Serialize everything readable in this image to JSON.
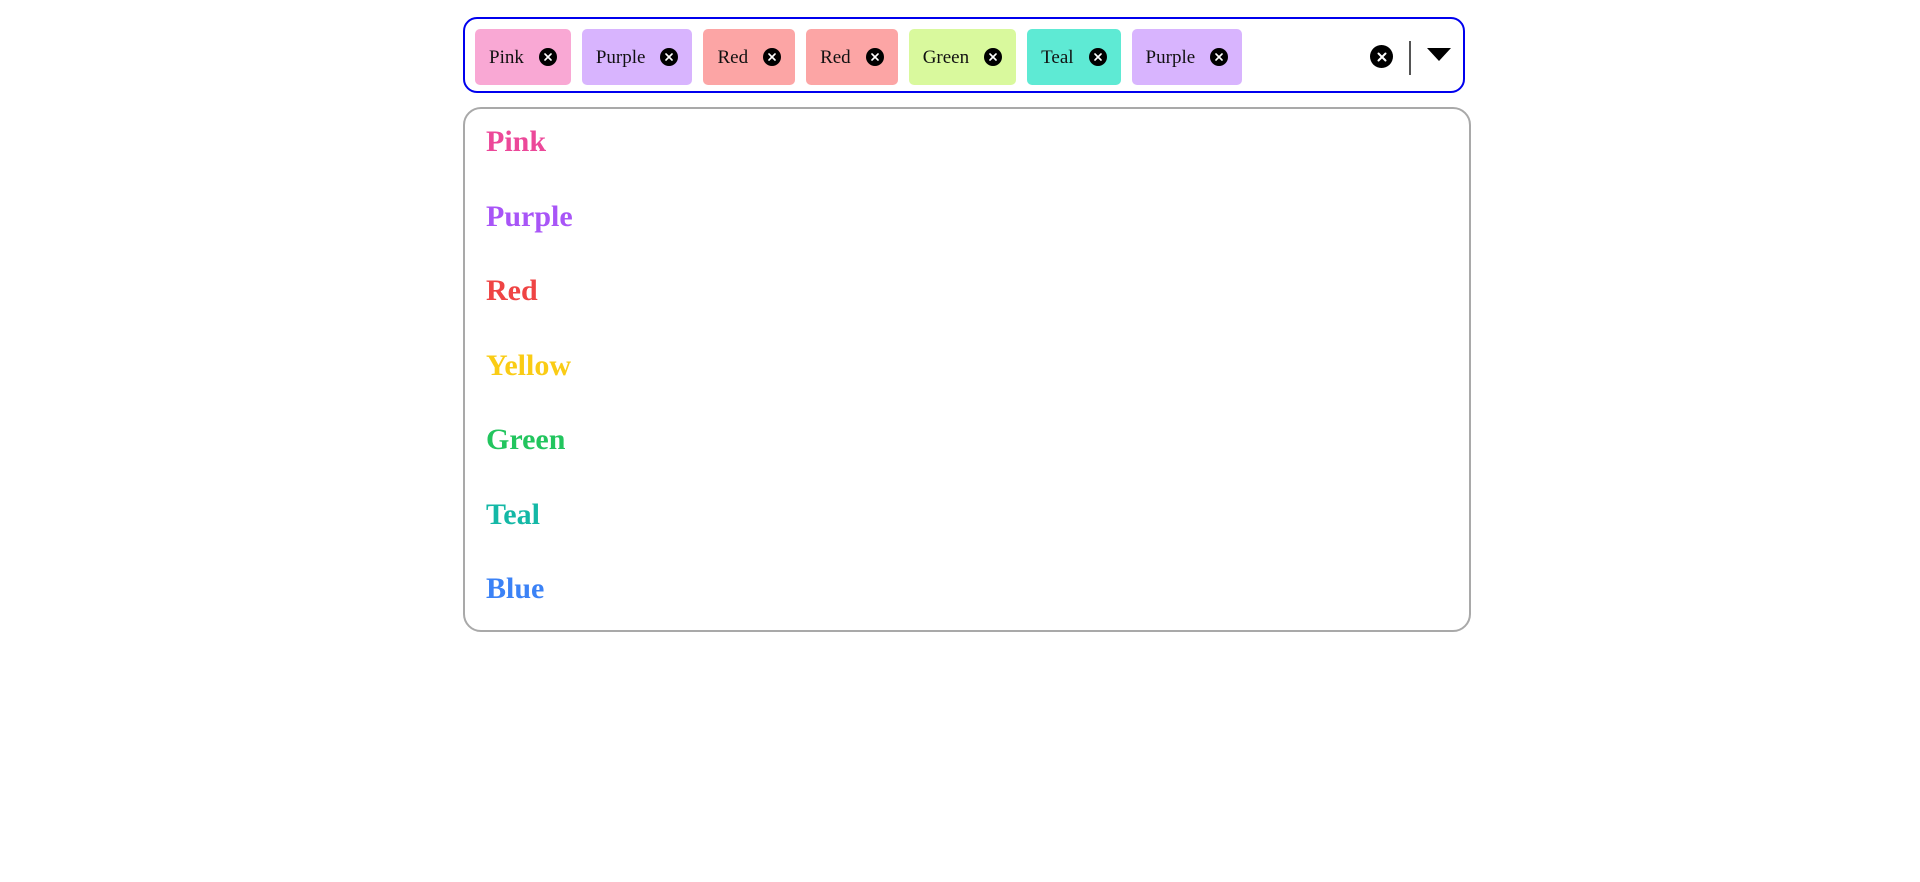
{
  "selected": [
    {
      "label": "Pink",
      "bg": "#f9a8d4"
    },
    {
      "label": "Purple",
      "bg": "#d8b4fe"
    },
    {
      "label": "Red",
      "bg": "#fca5a5"
    },
    {
      "label": "Red",
      "bg": "#fca5a5"
    },
    {
      "label": "Green",
      "bg": "#d9f99d"
    },
    {
      "label": "Teal",
      "bg": "#5eead4"
    },
    {
      "label": "Purple",
      "bg": "#d8b4fe"
    }
  ],
  "chip_remove_icon": "close-circle-icon",
  "clear_all_icon": "close-circle-icon",
  "dropdown_icon": "caret-down-icon",
  "control_border_color": "#0000ee",
  "options": [
    {
      "label": "Pink",
      "color": "#ec4899"
    },
    {
      "label": "Purple",
      "color": "#a855f7"
    },
    {
      "label": "Red",
      "color": "#ef4444"
    },
    {
      "label": "Yellow",
      "color": "#facc15"
    },
    {
      "label": "Green",
      "color": "#22c55e"
    },
    {
      "label": "Teal",
      "color": "#14b8a6"
    },
    {
      "label": "Blue",
      "color": "#3b82f6"
    }
  ]
}
